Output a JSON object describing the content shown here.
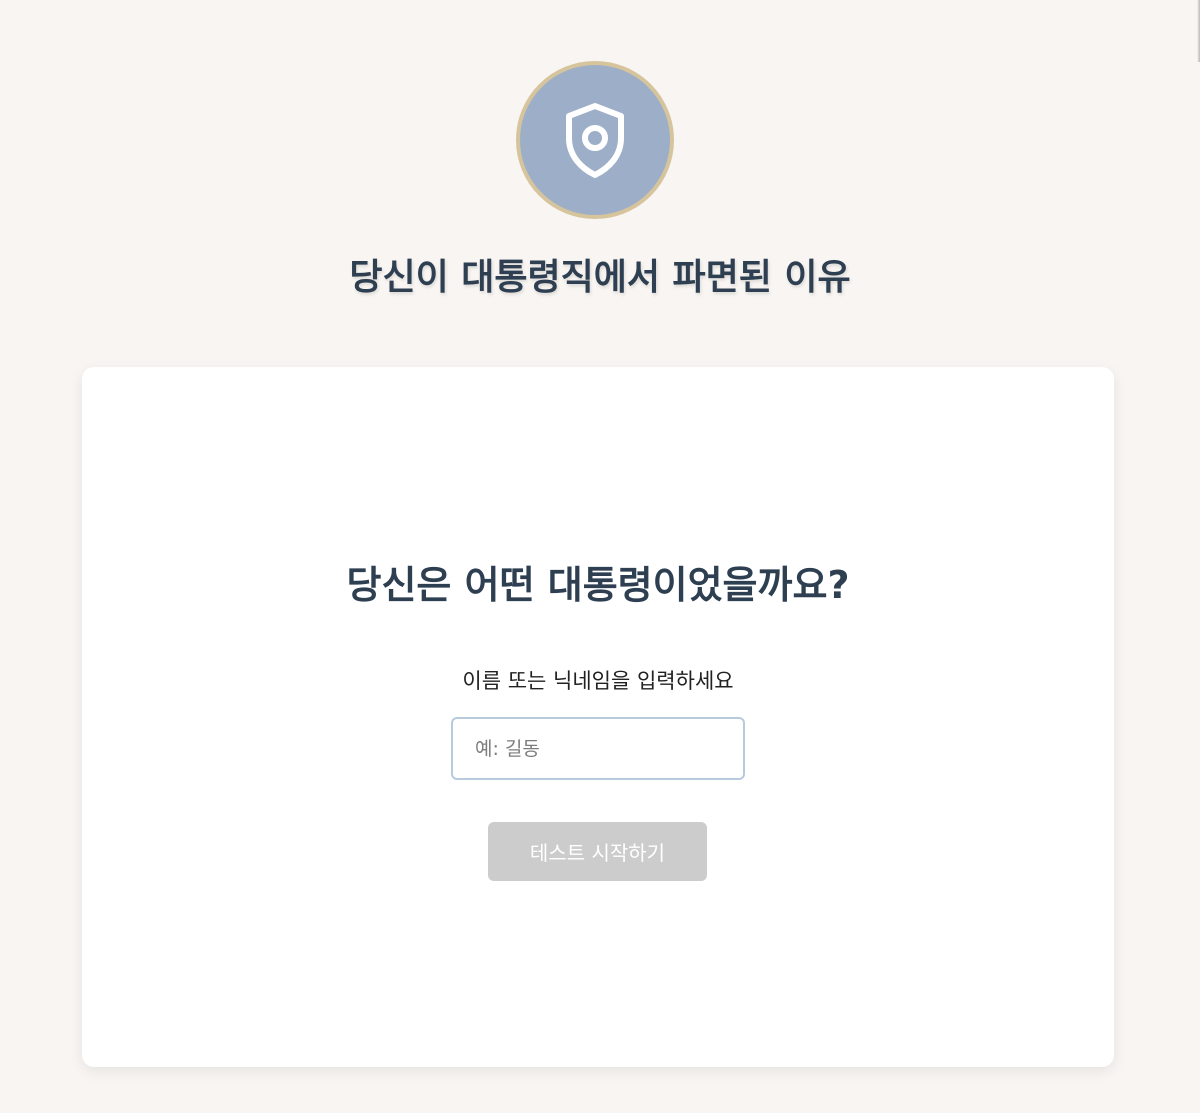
{
  "header": {
    "emblem_icon": "shield-icon",
    "title": "당신이 대통령직에서 파면된 이유"
  },
  "card": {
    "question": "당신은 어떤 대통령이었을까요?",
    "prompt": "이름 또는 닉네임을 입력하세요",
    "name_input": {
      "value": "",
      "placeholder": "예: 길동"
    },
    "start_button_label": "테스트 시작하기"
  },
  "colors": {
    "background": "#f8f5f2",
    "emblem_fill": "#9daec9",
    "emblem_ring": "#d6c49c",
    "title_text": "#2e3f52",
    "input_border": "#b8cade",
    "button_disabled": "#cccccc"
  }
}
